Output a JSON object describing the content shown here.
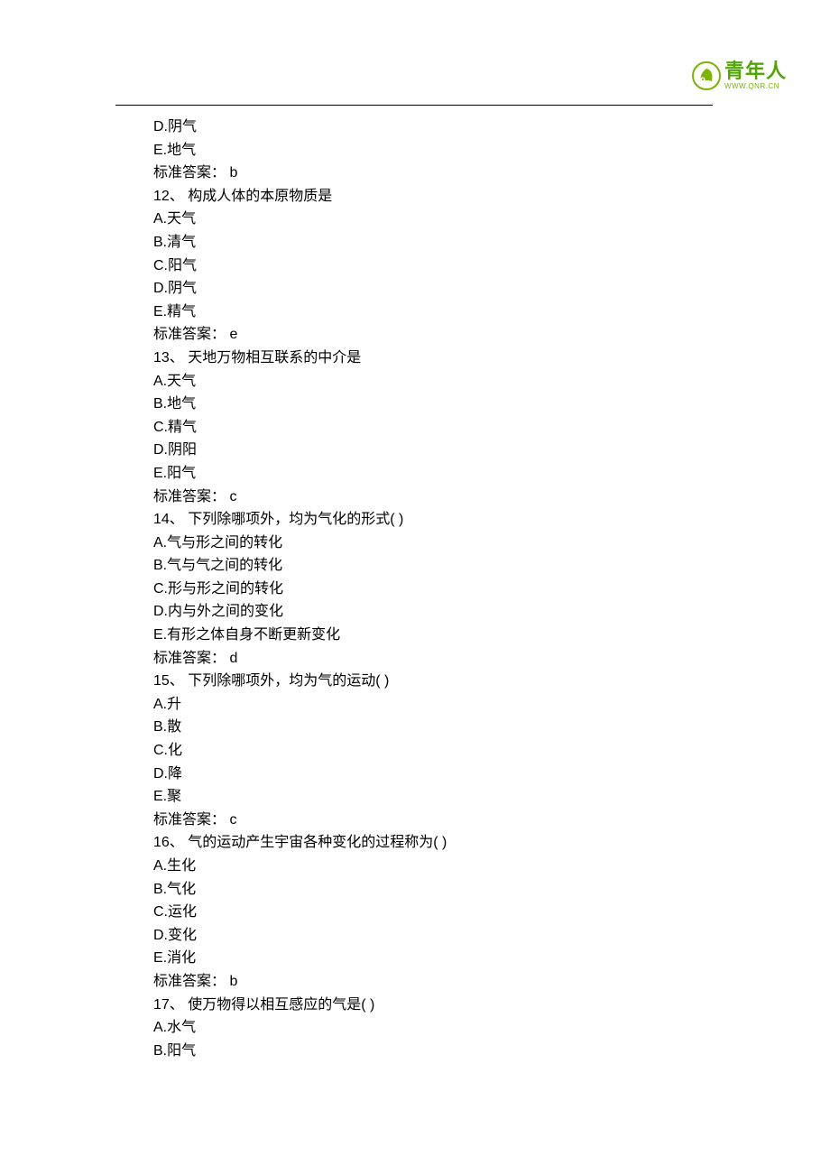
{
  "logo": {
    "main": "青年人",
    "sub": "WWW.QNR.CN"
  },
  "lines": [
    "D.阴气",
    "E.地气",
    "标准答案： b",
    "12、 构成人体的本原物质是",
    "A.天气",
    "B.清气",
    "C.阳气",
    "D.阴气",
    "E.精气",
    "标准答案： e",
    "13、 天地万物相互联系的中介是",
    "A.天气",
    "B.地气",
    "C.精气",
    "D.阴阳",
    "E.阳气",
    "标准答案： c",
    "14、 下列除哪项外，均为气化的形式( )",
    "A.气与形之间的转化",
    "B.气与气之间的转化",
    "C.形与形之间的转化",
    "D.内与外之间的变化",
    "E.有形之体自身不断更新变化",
    "标准答案： d",
    "15、 下列除哪项外，均为气的运动( )",
    "A.升",
    "B.散",
    "C.化",
    "D.降",
    "E.聚",
    "标准答案： c",
    "16、 气的运动产生宇宙各种变化的过程称为( )",
    "A.生化",
    "B.气化",
    "C.运化",
    "D.变化",
    "E.消化",
    "标准答案： b",
    "17、 使万物得以相互感应的气是( )",
    "A.水气",
    "B.阳气"
  ]
}
